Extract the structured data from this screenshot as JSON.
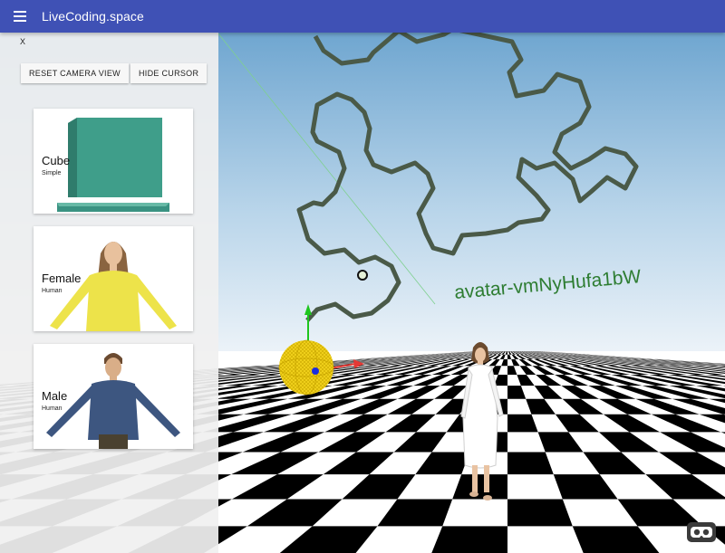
{
  "app": {
    "title": "LiveCoding.space",
    "menu_icon": "hamburger-menu-icon"
  },
  "panel": {
    "close_label": "X",
    "buttons": {
      "reset_camera": "RESET CAMERA VIEW",
      "hide_cursor": "HIDE CURSOR"
    },
    "cards": [
      {
        "title": "Cube",
        "subtitle": "Simple"
      },
      {
        "title": "Female",
        "subtitle": "Human"
      },
      {
        "title": "Male",
        "subtitle": "Human"
      }
    ]
  },
  "scene": {
    "avatar_label": "avatar-vmNyHufa1bW",
    "sky_color_top": "#7fb2d6",
    "sky_color_horizon": "#eaf2f8",
    "floor_colors": [
      "#000000",
      "#ffffff"
    ],
    "curve_color": "#4a5a48",
    "label_color": "#2e7d32",
    "accent_sphere": "#f2d21c"
  },
  "vr_button": {
    "icon": "vr-headset-icon"
  }
}
